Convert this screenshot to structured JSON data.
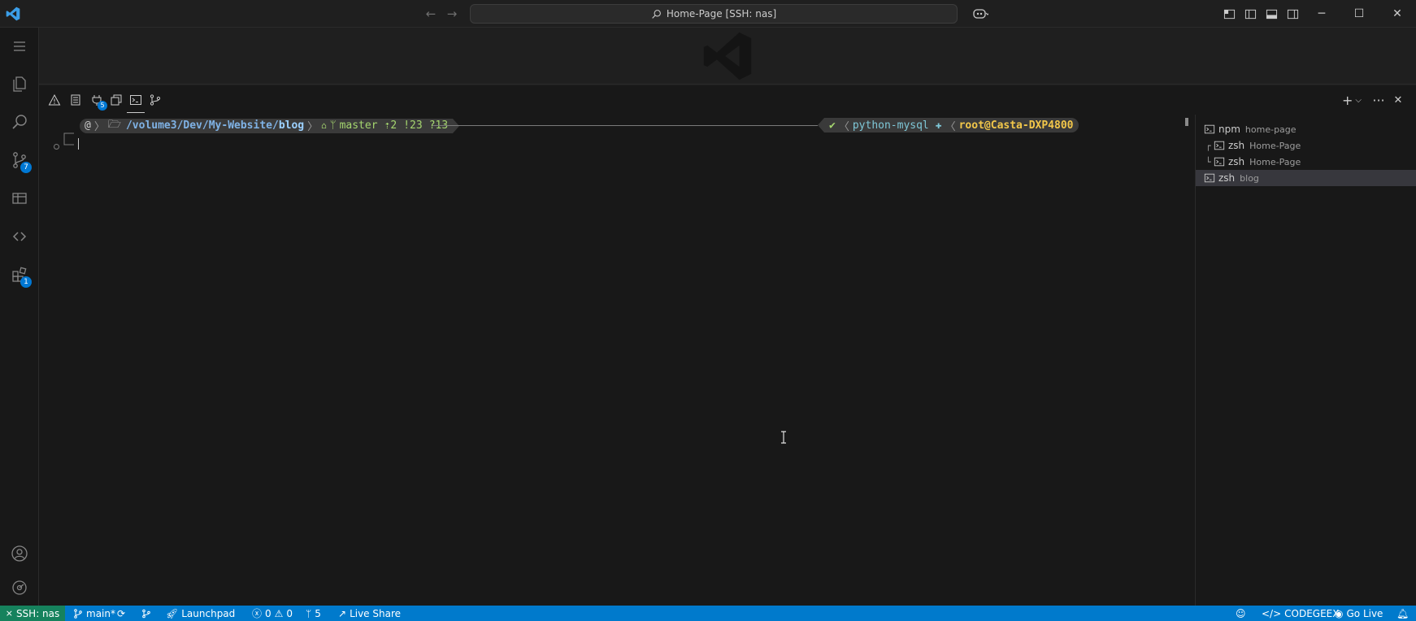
{
  "titlebar": {
    "search_text": "Home-Page [SSH: nas]"
  },
  "activitybar": {
    "badges": {
      "source_control": "7",
      "extensions": "1"
    }
  },
  "panel": {
    "tabs": [
      {
        "name": "problems"
      },
      {
        "name": "output"
      },
      {
        "name": "ports",
        "badge": "5"
      },
      {
        "name": "debug-console"
      },
      {
        "name": "terminal"
      },
      {
        "name": "gitlens"
      }
    ]
  },
  "terminal": {
    "prompt": {
      "os_icon": "@",
      "folder_icon": "🗁",
      "path_prefix": "/volume3/Dev/My-Website/",
      "path_last": "blog",
      "git_icon": "",
      "branch": "master",
      "ahead": "⇡2",
      "modified": "!23",
      "untracked": "?13",
      "status_ok": "✔",
      "venv": "python-mysql",
      "user_host": "root@Casta-DXP4800"
    },
    "list": [
      {
        "name": "npm",
        "desc": "home-page",
        "tree": "",
        "selected": false
      },
      {
        "name": "zsh",
        "desc": "Home-Page",
        "tree": "┌",
        "selected": false
      },
      {
        "name": "zsh",
        "desc": "Home-Page",
        "tree": "└",
        "selected": false
      },
      {
        "name": "zsh",
        "desc": "blog",
        "tree": "",
        "selected": true
      }
    ]
  },
  "statusbar": {
    "remote": "SSH: nas",
    "branch": "main*",
    "launchpad": "Launchpad",
    "errors": "0",
    "warnings": "0",
    "ports": "5",
    "live_share": "Live Share",
    "codegeex": "CODEGEEX",
    "go_live": "Go Live"
  },
  "colors": {
    "accent": "#007acc",
    "remote": "#16825d",
    "badge": "#0078d4"
  }
}
